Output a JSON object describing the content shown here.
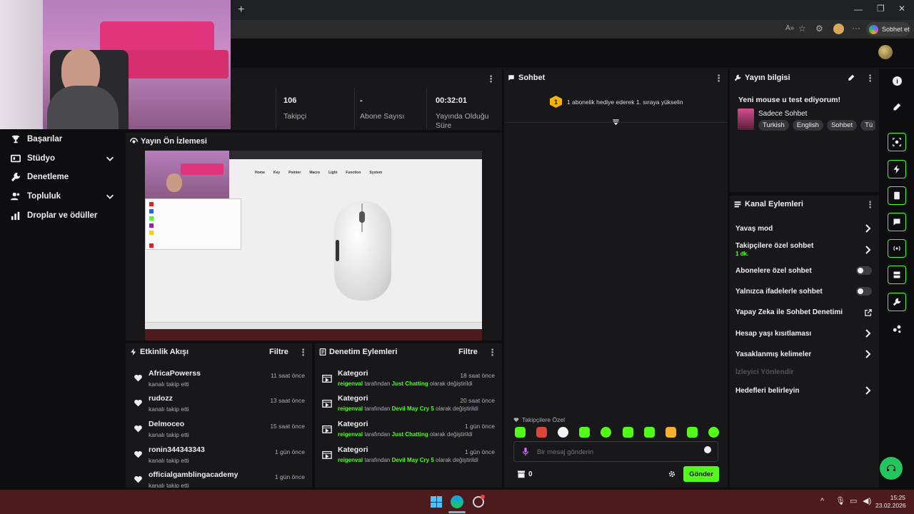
{
  "browser": {
    "new_tab": "+",
    "chat_button": "Sobhet et",
    "more": "···"
  },
  "sidebar": {
    "items": [
      {
        "label": "Başarılar",
        "icon": "trophy-icon"
      },
      {
        "label": "Stüdyo",
        "icon": "studio-icon",
        "expandable": true
      },
      {
        "label": "Denetleme",
        "icon": "wrench-icon"
      },
      {
        "label": "Topluluk",
        "icon": "community-icon",
        "expandable": true
      },
      {
        "label": "Droplar ve ödüller",
        "icon": "drops-icon"
      }
    ]
  },
  "stats": [
    {
      "value": "106",
      "label": "Takipçi"
    },
    {
      "value": "-",
      "label": "Abone Sayısı"
    },
    {
      "value": "00:32:01",
      "label": "Yayında Olduğu Süre"
    }
  ],
  "preview": {
    "title": "Yayın Ön İzlemesi",
    "nav": [
      "Home",
      "Key",
      "Pointer",
      "Macro",
      "Light",
      "Function",
      "System"
    ]
  },
  "activity": {
    "title": "Etkinlik Akışı",
    "filter": "Filtre",
    "items": [
      {
        "name": "AfricaPowerss",
        "action": "kanalı takip etti",
        "time": "11 saat önce"
      },
      {
        "name": "rudozz",
        "action": "kanalı takip etti",
        "time": "13 saat önce"
      },
      {
        "name": "Delmoceo",
        "action": "kanalı takip etti",
        "time": "15 saat önce"
      },
      {
        "name": "ronin344343343",
        "action": "kanalı takip etti",
        "time": "1 gün önce"
      },
      {
        "name": "officialgamblingacademy",
        "action": "kanalı takip etti",
        "time": "1 gün önce"
      }
    ]
  },
  "moderation": {
    "title": "Denetim Eylemleri",
    "filter": "Filtre",
    "items": [
      {
        "title": "Kategori",
        "user": "reigenval",
        "mid": "tarafından",
        "value": "Just Chatting",
        "end": "olarak değiştirildi",
        "time": "18 saat önce"
      },
      {
        "title": "Kategori",
        "user": "reigenval",
        "mid": "tarafından",
        "value": "Devil May Cry 5",
        "end": "olarak değiştirildi",
        "time": "20 saat önce"
      },
      {
        "title": "Kategori",
        "user": "reigenval",
        "mid": "tarafından",
        "value": "Just Chatting",
        "end": "olarak değiştirildi",
        "time": "1 gün önce"
      },
      {
        "title": "Kategori",
        "user": "reigenval",
        "mid": "tarafından",
        "value": "Devil May Cry 5",
        "end": "olarak değiştirildi",
        "time": "1 gün önce"
      }
    ]
  },
  "chat": {
    "title": "Sohbet",
    "gift_badge": "1",
    "gift_text": "1 abonelik hediye ederek 1. sıraya yükselin",
    "followers_label": "Takipçilere Özel",
    "input_placeholder": "Bir mesaj gönderin",
    "points": "0",
    "send": "Gönder",
    "emote_colors": [
      "#53fc18",
      "#e0453a",
      "#ffffff",
      "#53fc18",
      "#53fc18",
      "#53fc18",
      "#53fc18",
      "#f0b030",
      "#53fc18",
      "#53fc18"
    ]
  },
  "stream_info": {
    "title": "Yayın bilgisi",
    "stream_title": "Yeni mouse u test ediyorum!",
    "category": "Sadece Sohbet",
    "tags": [
      "Turkish",
      "English",
      "Sohbet",
      "Tü"
    ]
  },
  "channel_actions": {
    "title": "Kanal Eylemleri",
    "items": [
      {
        "label": "Yavaş mod",
        "type": "chevron"
      },
      {
        "label": "Takipçilere özel sohbet",
        "sub": "1 dk.",
        "type": "chevron"
      },
      {
        "label": "Abonelere özel sohbet",
        "type": "toggle"
      },
      {
        "label": "Yalnızca ifadelerle sohbet",
        "type": "toggle"
      },
      {
        "label": "Yapay Zeka ile Sohbet Denetimi",
        "type": "external"
      },
      {
        "label": "Hesap yaşı kısıtlaması",
        "type": "chevron"
      },
      {
        "label": "Yasaklanmış kelimeler",
        "type": "chevron"
      },
      {
        "label": "İzleyici Yönlendir",
        "type": "disabled"
      },
      {
        "label": "Hedefleri belirleyin",
        "type": "chevron"
      }
    ]
  },
  "taskbar": {
    "time": "15:25",
    "date": "23.02.2026"
  },
  "colors": {
    "accent": "#53fc18",
    "panel": "#18181b",
    "bg": "#0e0e10",
    "taskbar": "#4d1a1e"
  }
}
